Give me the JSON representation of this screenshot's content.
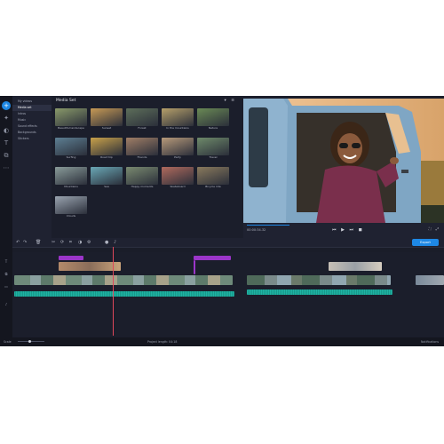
{
  "colors": {
    "accent": "#1e88e5",
    "title_clip": "#9b35c9",
    "audio": "#1fb3a3",
    "playhead": "#e0475a"
  },
  "sidebar": {
    "items": [
      {
        "label": "My videos",
        "active": false
      },
      {
        "label": "Media set",
        "active": true
      },
      {
        "label": "Intros",
        "active": false
      },
      {
        "label": "Music",
        "active": false
      },
      {
        "label": "Sound effects",
        "active": false
      },
      {
        "label": "Backgrounds",
        "active": false
      },
      {
        "label": "Stickers",
        "active": false
      }
    ]
  },
  "media": {
    "title": "Media Set",
    "thumbs": [
      {
        "label": "Beautiful landscape",
        "color": "#8a9a6a"
      },
      {
        "label": "Sunset",
        "color": "#c79a55"
      },
      {
        "label": "Forest",
        "color": "#5d6e5a"
      },
      {
        "label": "In the mountains",
        "color": "#b6a06a"
      },
      {
        "label": "Nature",
        "color": "#6a8a55"
      },
      {
        "label": "Surfing",
        "color": "#5d7f93"
      },
      {
        "label": "Road trip",
        "color": "#c8a14a"
      },
      {
        "label": "Friends",
        "color": "#a07e66"
      },
      {
        "label": "Party",
        "color": "#b79a7a"
      },
      {
        "label": "Travel",
        "color": "#6e8a6a"
      },
      {
        "label": "Mountains",
        "color": "#8a9c9a"
      },
      {
        "label": "Sea",
        "color": "#6aa8b6"
      },
      {
        "label": "Happy moments",
        "color": "#7a8a70"
      },
      {
        "label": "Skateboard",
        "color": "#b06a5d"
      },
      {
        "label": "Bicycle ride",
        "color": "#8a7a5d"
      },
      {
        "label": "Clouds",
        "color": "#9aa4b0"
      }
    ]
  },
  "preview": {
    "time": "00:00:34.32",
    "export_label": "Export"
  },
  "status": {
    "left": "Scale",
    "center": "Project length: 04:18",
    "right": "Notifications"
  }
}
